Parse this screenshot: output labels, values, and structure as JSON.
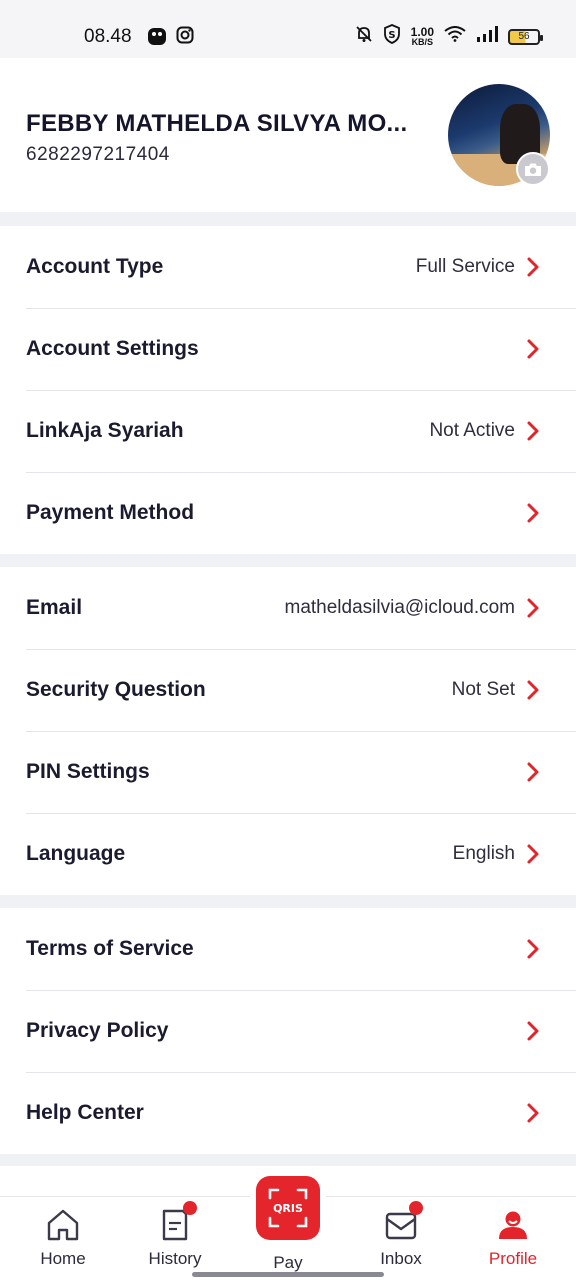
{
  "status_bar": {
    "time": "08.48",
    "speed_value": "1.00",
    "speed_unit": "KB/S",
    "battery": "56"
  },
  "profile": {
    "name": "FEBBY MATHELDA SILVYA MO...",
    "phone": "6282297217404"
  },
  "sections": [
    {
      "rows": [
        {
          "label": "Account Type",
          "value": "Full Service"
        },
        {
          "label": "Account Settings",
          "value": ""
        },
        {
          "label": "LinkAja Syariah",
          "value": "Not Active"
        },
        {
          "label": "Payment Method",
          "value": ""
        }
      ]
    },
    {
      "rows": [
        {
          "label": "Email",
          "value": "matheldasilvia@icloud.com"
        },
        {
          "label": "Security Question",
          "value": "Not Set"
        },
        {
          "label": "PIN Settings",
          "value": ""
        },
        {
          "label": "Language",
          "value": "English"
        }
      ]
    },
    {
      "rows": [
        {
          "label": "Terms of Service",
          "value": ""
        },
        {
          "label": "Privacy Policy",
          "value": ""
        },
        {
          "label": "Help Center",
          "value": ""
        }
      ]
    }
  ],
  "bottom_nav": {
    "home": "Home",
    "history": "History",
    "pay": "Pay",
    "pay_logo_text": "QRIS",
    "inbox": "Inbox",
    "profile": "Profile"
  },
  "colors": {
    "accent": "#e3242b",
    "background": "#f0f1f5"
  }
}
